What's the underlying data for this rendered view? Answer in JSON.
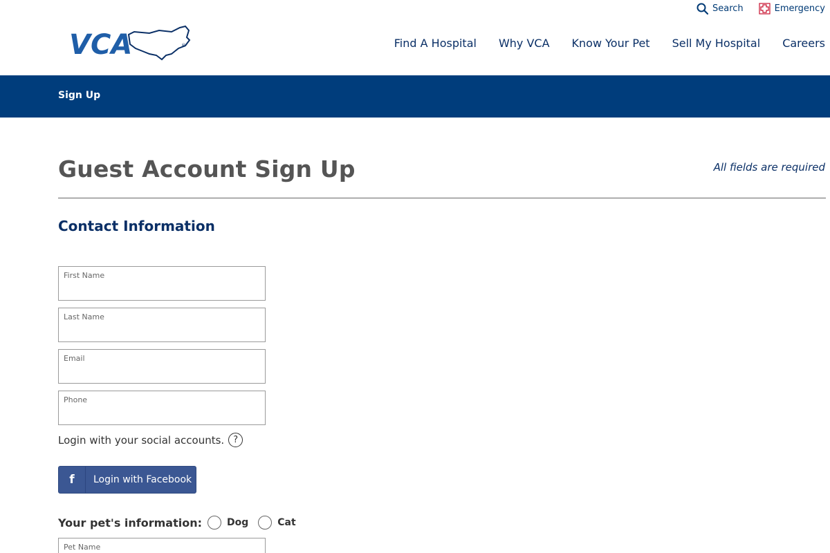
{
  "header": {
    "logo_text": "VCA",
    "utility": {
      "search_label": "Search",
      "emergency_label": "Emergency"
    },
    "nav": [
      {
        "label": "Find A Hospital"
      },
      {
        "label": "Why VCA"
      },
      {
        "label": "Know Your Pet"
      },
      {
        "label": "Sell My Hospital"
      },
      {
        "label": "Careers"
      }
    ]
  },
  "bluebar": {
    "label": "Sign Up"
  },
  "main": {
    "title": "Guest Account Sign Up",
    "required_note": "All fields are required",
    "contact_section_title": "Contact Information",
    "fields": {
      "first_name": {
        "label": "First Name",
        "value": ""
      },
      "last_name": {
        "label": "Last Name",
        "value": ""
      },
      "email": {
        "label": "Email",
        "value": ""
      },
      "phone": {
        "label": "Phone",
        "value": ""
      },
      "pet_name": {
        "label": "Pet Name",
        "value": ""
      }
    },
    "social_prompt": "Login with your social accounts.",
    "help_glyph": "?",
    "facebook": {
      "icon": "f",
      "label": "Login with Facebook"
    },
    "pet_info": {
      "label": "Your pet's information:",
      "options": [
        {
          "label": "Dog",
          "selected": false
        },
        {
          "label": "Cat",
          "selected": false
        }
      ]
    }
  },
  "colors": {
    "brand_blue": "#003d7c",
    "nav_text": "#0a2f66",
    "facebook_blue": "#3b5793",
    "emergency_red": "#c8102e"
  },
  "icons": {
    "search": "search-icon",
    "emergency": "emergency-cross-icon",
    "facebook": "facebook-icon",
    "help": "help-icon",
    "logo_map": "usa-map-icon"
  }
}
